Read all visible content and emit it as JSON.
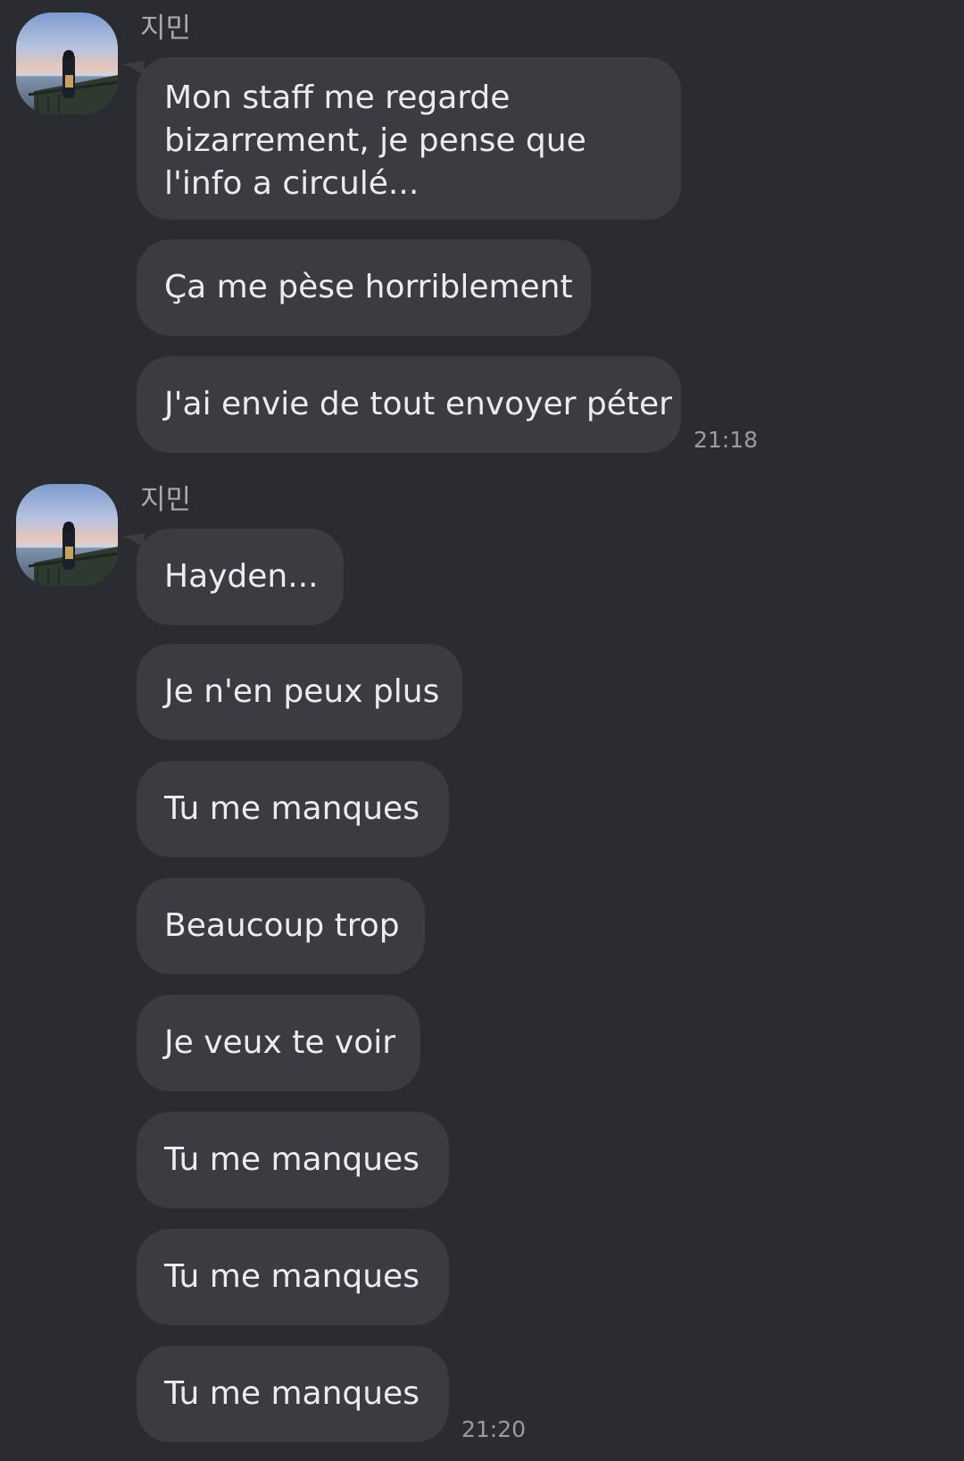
{
  "chat": {
    "groups": [
      {
        "sender": "지민",
        "avatar_icon": "profile-photo-sunset-sea",
        "messages": [
          "Mon staff me regarde bizarrement, je pense que l'info a circulé...",
          "Ça me pèse horriblement",
          "J'ai envie de tout envoyer péter"
        ],
        "time": "21:18"
      },
      {
        "sender": "지민",
        "avatar_icon": "profile-photo-sunset-sea",
        "messages": [
          "Hayden...",
          "Je n'en peux plus",
          "Tu me manques",
          "Beaucoup trop",
          "Je veux te voir",
          "Tu me manques",
          "Tu me manques",
          "Tu me manques"
        ],
        "time": "21:20"
      }
    ]
  },
  "colors": {
    "background": "#2a2c31",
    "bubble": "#3a3c42",
    "text": "#ececec",
    "sender": "#a8aab0",
    "timestamp": "#9a9ca2"
  }
}
